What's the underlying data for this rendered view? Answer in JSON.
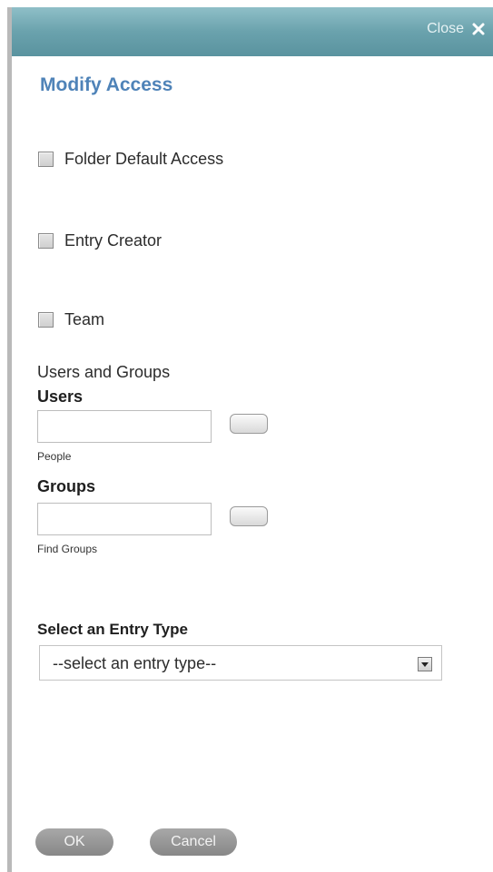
{
  "dialog": {
    "close_label": "Close",
    "title": "Modify Access"
  },
  "checkboxes": [
    {
      "label": "Folder Default Access",
      "checked": false
    },
    {
      "label": "Entry Creator",
      "checked": false
    },
    {
      "label": "Team",
      "checked": false
    }
  ],
  "users_and_groups": {
    "section_label": "Users and Groups",
    "users_label": "Users",
    "users_value": "",
    "people_label": "People",
    "groups_label": "Groups",
    "groups_value": "",
    "find_groups_label": "Find Groups"
  },
  "entry_type": {
    "label": "Select an Entry Type",
    "selected": "--select an entry type--"
  },
  "actions": {
    "ok_label": "OK",
    "cancel_label": "Cancel"
  },
  "colors": {
    "titlebar": "#6aa2ad",
    "title_text": "#4f83b8",
    "button_gray": "#959595"
  }
}
